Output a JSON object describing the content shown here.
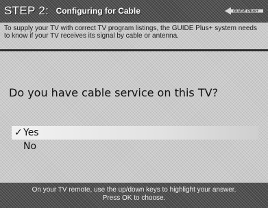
{
  "header": {
    "step_label": "STEP 2:",
    "subtitle": "Configuring for Cable",
    "logo_text": "GUIDE Plus+",
    "logo_icon": "guide-plus-logo"
  },
  "intro_text": "To supply your TV with correct TV program listings, the GUIDE Plus+ system needs to know if your TV receives its signal by cable or antenna.",
  "question": "Do you have cable service on this TV?",
  "options": [
    {
      "label": "Yes",
      "selected": true,
      "check": "✓"
    },
    {
      "label": "No",
      "selected": false
    }
  ],
  "footer": {
    "line1": "On your TV remote, use the up/down keys to highlight your answer.",
    "line2": "Press OK to choose."
  },
  "colors": {
    "background": "#c9c9c9",
    "bar": "#4e4e4e",
    "highlight": "#ececec",
    "text": "#111111"
  }
}
